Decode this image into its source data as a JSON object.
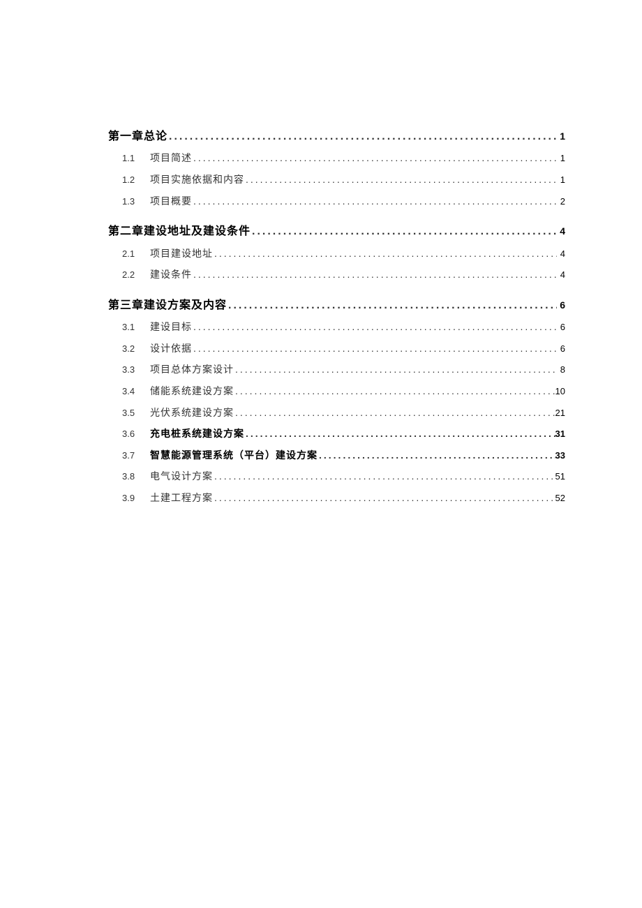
{
  "toc": {
    "chapters": [
      {
        "title": "第一章总论",
        "page": "1",
        "subs": [
          {
            "num": "1.1",
            "title": "项目简述",
            "page": "1",
            "bold": false
          },
          {
            "num": "1.2",
            "title": "项目实施依据和内容",
            "page": "1",
            "bold": false
          },
          {
            "num": "1.3",
            "title": "项目概要",
            "page": "2",
            "bold": false
          }
        ]
      },
      {
        "title": "第二章建设地址及建设条件",
        "page": "4",
        "subs": [
          {
            "num": "2.1",
            "title": "项目建设地址",
            "page": "4",
            "bold": false
          },
          {
            "num": "2.2",
            "title": "建设条件",
            "page": "4",
            "bold": false
          }
        ]
      },
      {
        "title": "第三章建设方案及内容",
        "page": "6",
        "subs": [
          {
            "num": "3.1",
            "title": "建设目标",
            "page": "6",
            "bold": false
          },
          {
            "num": "3.2",
            "title": "设计依据",
            "page": "6",
            "bold": false
          },
          {
            "num": "3.3",
            "title": "项目总体方案设计",
            "page": "8",
            "bold": false
          },
          {
            "num": "3.4",
            "title": "储能系统建设方案",
            "page": "10",
            "bold": false
          },
          {
            "num": "3.5",
            "title": "光伏系统建设方案",
            "page": "21",
            "bold": false
          },
          {
            "num": "3.6",
            "title": "充电桩系统建设方案",
            "page": "31",
            "bold": true
          },
          {
            "num": "3.7",
            "title": "智慧能源管理系统（平台）建设方案",
            "page": "33",
            "bold": true
          },
          {
            "num": "3.8",
            "title": "电气设计方案",
            "page": "51",
            "bold": false
          },
          {
            "num": "3.9",
            "title": "土建工程方案",
            "page": "52",
            "bold": false
          }
        ]
      }
    ]
  }
}
